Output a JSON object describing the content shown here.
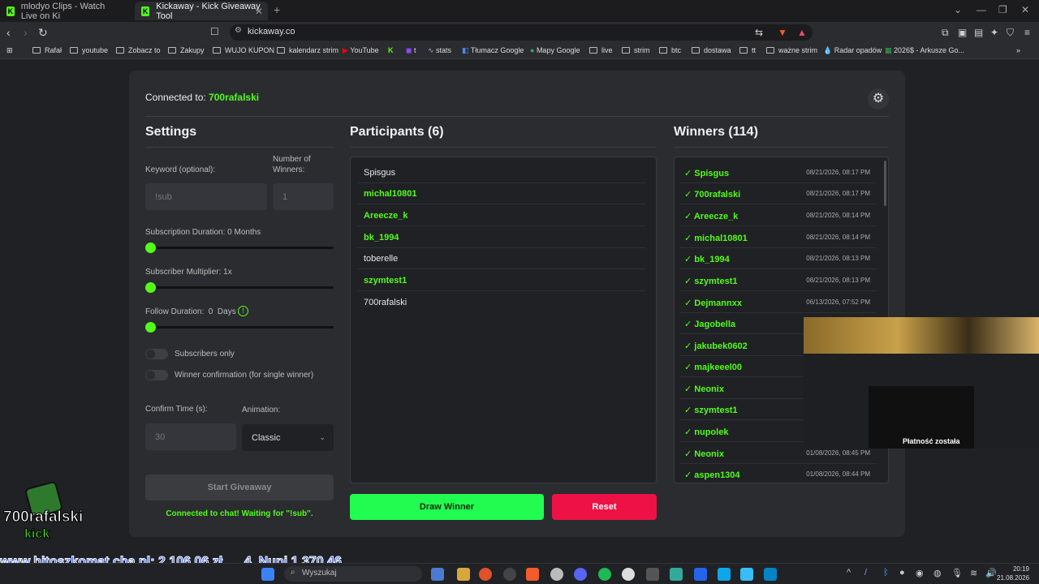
{
  "browser": {
    "tabs": [
      {
        "label": "mlodyo Clips - Watch Live on Ki"
      },
      {
        "label": "Kickaway - Kick Giveaway Tool"
      }
    ],
    "url": "kickaway.co",
    "bookmarks": [
      "Rafał",
      "youtube",
      "Zobacz to",
      "Zakupy",
      "WUJO KUPON",
      "kalendarz strim",
      "YouTube",
      "t",
      "stats",
      "Tłumacz Google",
      "Mapy Google",
      "live",
      "strim",
      "btc",
      "dostawa",
      "tt",
      "ważne strim",
      "Radar opadów",
      "2026$ - Arkusze Go..."
    ]
  },
  "app": {
    "connected_label": "Connected to:",
    "connected_user": "700rafalski",
    "settings": {
      "title": "Settings",
      "keyword_label": "Keyword (optional):",
      "keyword_placeholder": "!sub",
      "winners_label": "Number of Winners:",
      "winners_value": "1",
      "sub_duration_label": "Subscription Duration: 0 Months",
      "sub_multiplier_label": "Subscriber Multiplier: 1x",
      "follow_duration_label": "Follow Duration:  0  Days",
      "subscribers_only_label": "Subscribers only",
      "winner_confirm_label": "Winner confirmation (for single winner)",
      "confirm_time_label": "Confirm Time (s):",
      "confirm_time_value": "30",
      "animation_label": "Animation:",
      "animation_value": "Classic",
      "start_button": "Start Giveaway",
      "status": "Connected to chat! Waiting for \"!sub\"."
    },
    "participants": {
      "title": "Participants (6)",
      "list": [
        {
          "name": "Spisgus",
          "sub": false
        },
        {
          "name": "michal10801",
          "sub": true
        },
        {
          "name": "Areecze_k",
          "sub": true
        },
        {
          "name": "bk_1994",
          "sub": true
        },
        {
          "name": "toberelle",
          "sub": false
        },
        {
          "name": "szymtest1",
          "sub": true
        },
        {
          "name": "700rafalski",
          "sub": false
        }
      ],
      "draw_button": "Draw Winner",
      "reset_button": "Reset"
    },
    "winners": {
      "title": "Winners (114)",
      "list": [
        {
          "name": "✓ Spisgus",
          "date": "08/21/2026, 08:17 PM"
        },
        {
          "name": "✓ 700rafalski",
          "date": "08/21/2026, 08:17 PM"
        },
        {
          "name": "✓ Areecze_k",
          "date": "08/21/2026, 08:14 PM"
        },
        {
          "name": "✓ michal10801",
          "date": "08/21/2026, 08:14 PM"
        },
        {
          "name": "✓ bk_1994",
          "date": "08/21/2026, 08:13 PM"
        },
        {
          "name": "✓ szymtest1",
          "date": "08/21/2026, 08:13 PM"
        },
        {
          "name": "✓ Dejmannxx",
          "date": "06/13/2026, 07:52 PM"
        },
        {
          "name": "✓ Jagobella",
          "date": ""
        },
        {
          "name": "✓ jakubek0602",
          "date": ""
        },
        {
          "name": "✓ majkeeel00",
          "date": ""
        },
        {
          "name": "✓ Neonix",
          "date": ""
        },
        {
          "name": "✓ szymtest1",
          "date": ""
        },
        {
          "name": "✓ nupolek",
          "date": ""
        },
        {
          "name": "✓ Neonix",
          "date": "01/08/2026, 08:45 PM"
        },
        {
          "name": "✓ aspen1304",
          "date": "01/08/2026, 08:44 PM"
        }
      ]
    }
  },
  "overlay": {
    "logo_text": "700rafalski",
    "logo_sub": "kick",
    "ticker": "www.hitoszkomat.cba.pl: 2 106,06 zł      4. Nupi 1 370,46",
    "camera_caption": "Płatność została"
  },
  "taskbar": {
    "search_placeholder": "Wyszukaj",
    "time": "20:19",
    "date": "21.08.2026"
  }
}
